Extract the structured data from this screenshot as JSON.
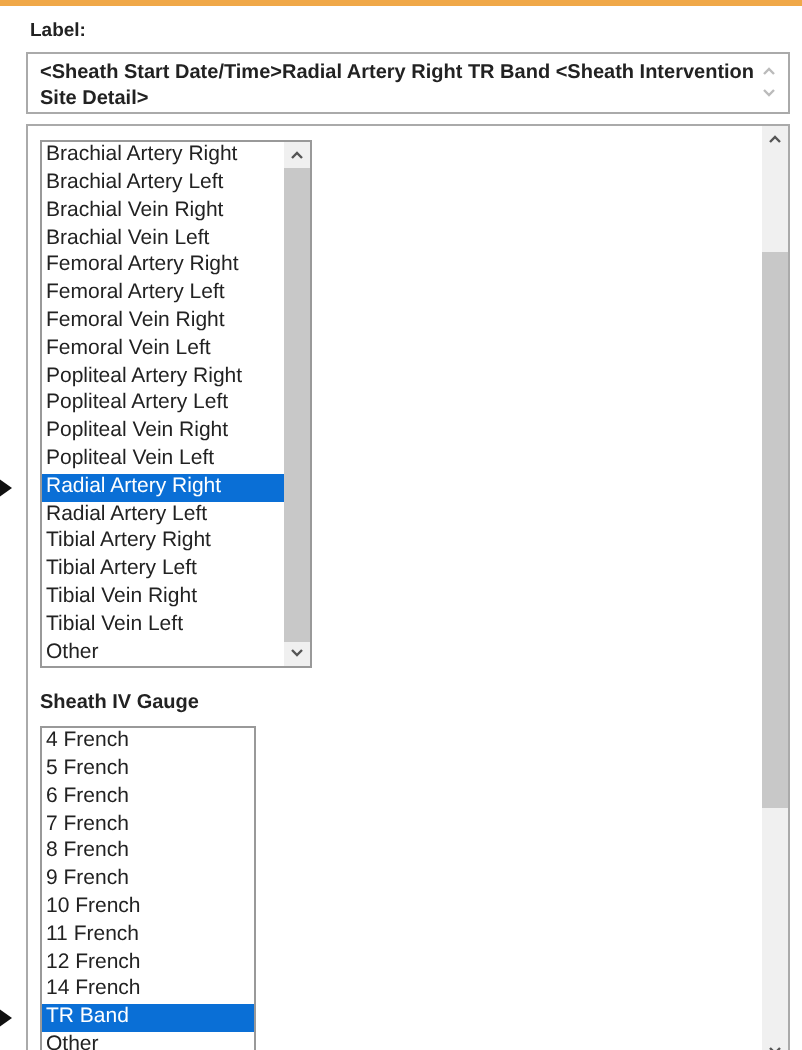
{
  "label": "Label:",
  "label_value": "<Sheath Start Date/Time>Radial Artery Right TR Band <Sheath Intervention Site Detail>",
  "site_list": {
    "items": [
      {
        "text": "Brachial Artery Right",
        "selected": false
      },
      {
        "text": "Brachial Artery Left",
        "selected": false
      },
      {
        "text": "Brachial Vein Right",
        "selected": false
      },
      {
        "text": "Brachial Vein Left",
        "selected": false
      },
      {
        "text": "Femoral Artery Right",
        "selected": false
      },
      {
        "text": "Femoral Artery Left",
        "selected": false
      },
      {
        "text": "Femoral Vein Right",
        "selected": false
      },
      {
        "text": "Femoral Vein Left",
        "selected": false
      },
      {
        "text": "Popliteal Artery Right",
        "selected": false
      },
      {
        "text": "Popliteal Artery Left",
        "selected": false
      },
      {
        "text": "Popliteal Vein Right",
        "selected": false
      },
      {
        "text": "Popliteal Vein Left",
        "selected": false
      },
      {
        "text": "Radial Artery Right",
        "selected": true
      },
      {
        "text": "Radial Artery Left",
        "selected": false
      },
      {
        "text": "Tibial Artery Right",
        "selected": false
      },
      {
        "text": "Tibial Artery Left",
        "selected": false
      },
      {
        "text": "Tibial Vein Right",
        "selected": false
      },
      {
        "text": "Tibial Vein Left",
        "selected": false
      },
      {
        "text": "Other",
        "selected": false
      }
    ]
  },
  "gauge_title": "Sheath IV Gauge",
  "gauge_list": {
    "items": [
      {
        "text": "4 French",
        "selected": false
      },
      {
        "text": "5 French",
        "selected": false
      },
      {
        "text": "6 French",
        "selected": false
      },
      {
        "text": "7 French",
        "selected": false
      },
      {
        "text": "8 French",
        "selected": false
      },
      {
        "text": "9 French",
        "selected": false
      },
      {
        "text": "10 French",
        "selected": false
      },
      {
        "text": "11 French",
        "selected": false
      },
      {
        "text": "12 French",
        "selected": false
      },
      {
        "text": "14 French",
        "selected": false
      },
      {
        "text": "TR Band",
        "selected": true
      },
      {
        "text": "Other",
        "selected": false
      }
    ]
  }
}
